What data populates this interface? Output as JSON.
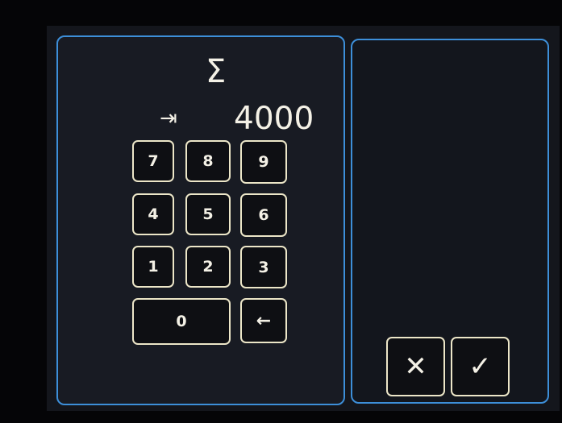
{
  "display": {
    "sum_symbol": "Σ",
    "tab_symbol": "⇥",
    "value": "4000"
  },
  "keypad": {
    "k7": "7",
    "k8": "8",
    "k9": "9",
    "k4": "4",
    "k5": "5",
    "k6": "6",
    "k1": "1",
    "k2": "2",
    "k3": "3",
    "k0": "0",
    "backspace": "←"
  },
  "actions": {
    "cancel": "✕",
    "confirm": "✓"
  },
  "colors": {
    "panel_border": "#3d8fd9",
    "button_border": "#ece6c8",
    "text": "#f4f1e6"
  }
}
